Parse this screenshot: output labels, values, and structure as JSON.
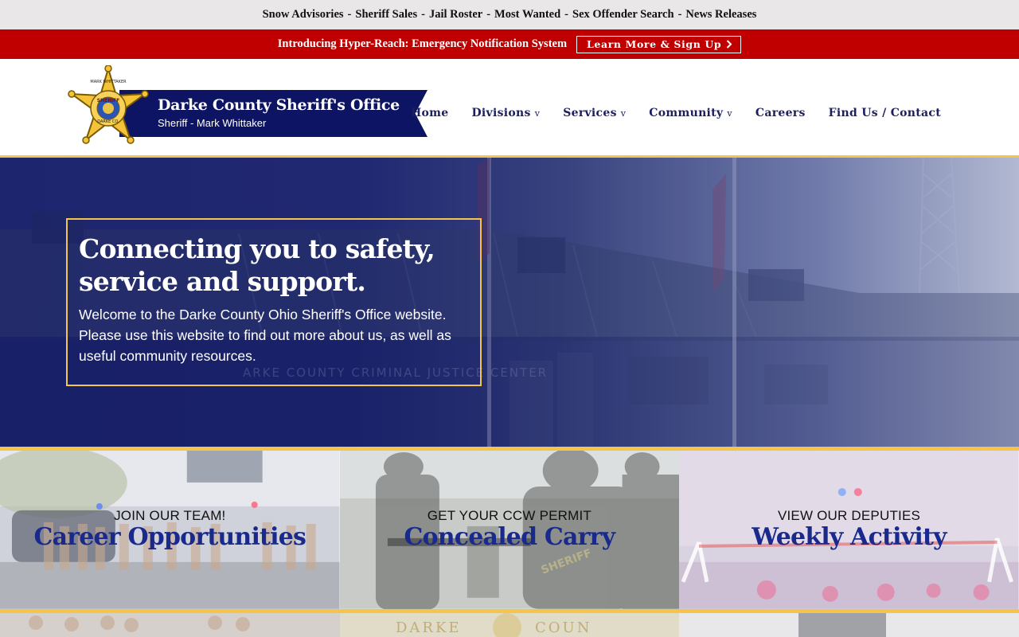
{
  "quicklinks": {
    "items": [
      "Snow Advisories",
      "Sheriff Sales",
      "Jail Roster",
      "Most Wanted",
      "Sex Offender Search",
      "News Releases"
    ],
    "separator": "-"
  },
  "alert": {
    "text": "Introducing Hyper-Reach: Emergency Notification System",
    "cta_label": "Learn More & Sign Up",
    "cta_icon": "chevron-right-icon"
  },
  "brand": {
    "title": "Darke County Sheriff's Office",
    "subtitle": "Sheriff - Mark Whittaker",
    "logo_icon": "sheriff-star-badge",
    "badge_text_top": "MARK WHITTAKER",
    "badge_text_mid": "SHERIFF",
    "badge_text_bottom": "DARKE CO."
  },
  "nav": {
    "items": [
      {
        "label": "Home",
        "has_dropdown": false
      },
      {
        "label": "Divisions",
        "has_dropdown": true
      },
      {
        "label": "Services",
        "has_dropdown": true
      },
      {
        "label": "Community",
        "has_dropdown": true
      },
      {
        "label": "Careers",
        "has_dropdown": false
      },
      {
        "label": "Find Us / Contact",
        "has_dropdown": false
      }
    ],
    "caret": "v"
  },
  "hero": {
    "title": "Connecting you to safety, service and support.",
    "text": "Welcome to the Darke County Ohio Sheriff's Office website. Please use this website to find out more about us, as well as useful community resources.",
    "photo_sign": "ARKE COUNTY CRIMINAL JUSTICE CENTER"
  },
  "cards": [
    {
      "kicker": "JOIN OUR TEAM!",
      "title": "Career Opportunities"
    },
    {
      "kicker": "GET YOUR CCW PERMIT",
      "title": "Concealed Carry"
    },
    {
      "kicker": "VIEW OUR DEPUTIES",
      "title": "Weekly Activity"
    }
  ],
  "colors": {
    "navy": "#0d1464",
    "gold": "#f4c54a",
    "alert_red": "#c00000",
    "link_navy": "#1a1f5e",
    "card_title_blue": "#1a2a8c"
  }
}
